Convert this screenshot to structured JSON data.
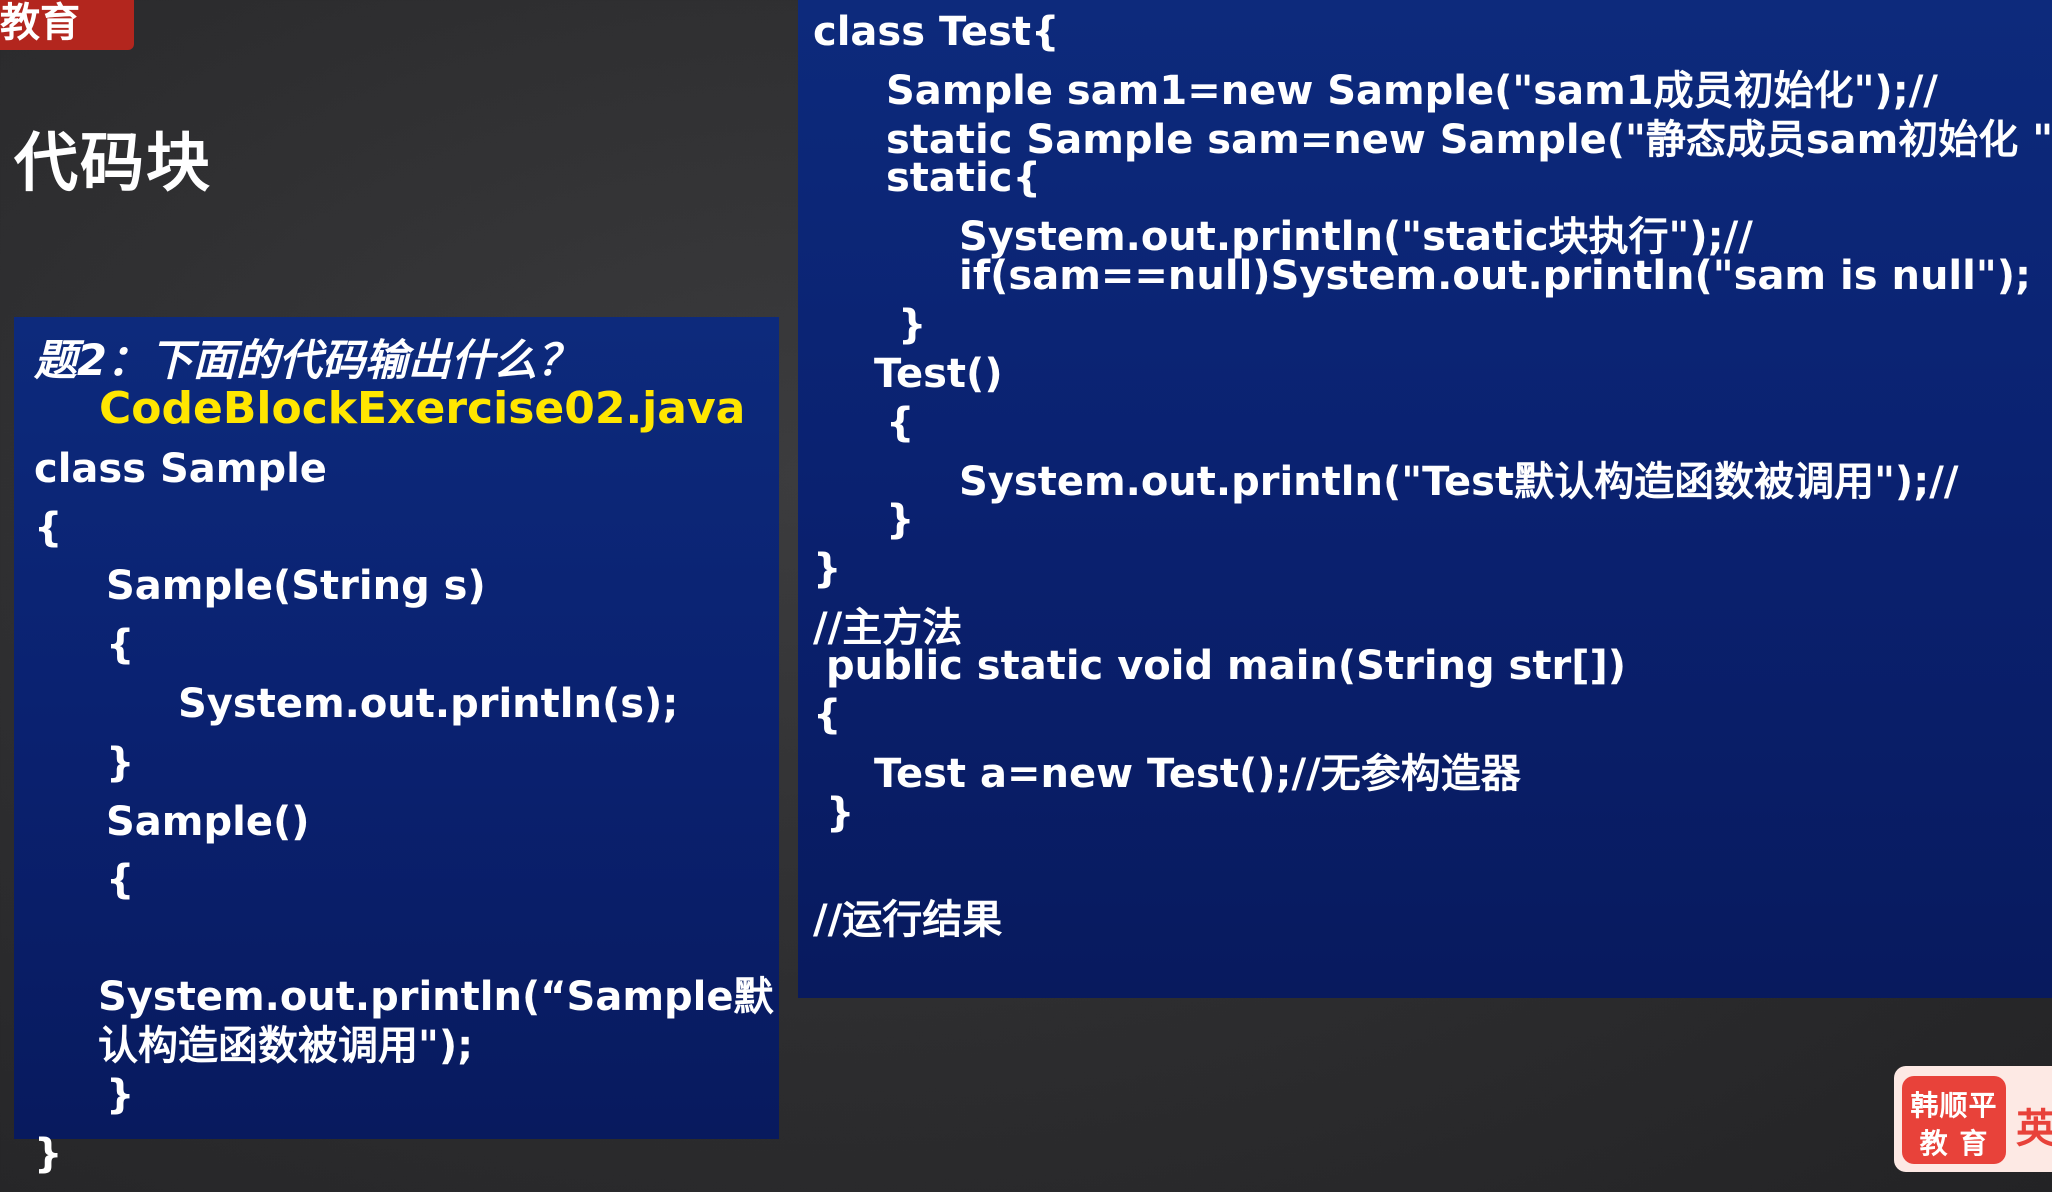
{
  "header": {
    "brand_fragment": "教育",
    "title": "代码块"
  },
  "question_panel": {
    "question": "题2：下面的代码输出什么？",
    "filename": "CodeBlockExercise02.java",
    "code_lines": [
      "class Sample",
      "{",
      "Sample(String s)",
      "{",
      "System.out.println(s);",
      "}",
      "Sample()",
      "{",
      "System.out.println(“Sample默",
      "认构造函数被调用\");",
      "}",
      "}"
    ]
  },
  "code_panel": {
    "code_lines": [
      "class Test{",
      "Sample sam1=new Sample(\"sam1成员初始化\");//",
      "static Sample sam=new Sample(\"静态成员sam初始化 \");//",
      "static{",
      "System.out.println(\"static块执行\");//",
      "if(sam==null)System.out.println(\"sam is null\");",
      "}",
      "Test()",
      "{",
      "System.out.println(\"Test默认构造函数被调用\");//",
      "}",
      "}",
      "//主方法",
      "public static void  main(String  str[])",
      "{",
      "Test a=new Test();//无参构造器",
      "}",
      "//运行结果"
    ]
  },
  "logo": {
    "line1": "韩顺平",
    "line2": "教 育",
    "side": "英"
  }
}
